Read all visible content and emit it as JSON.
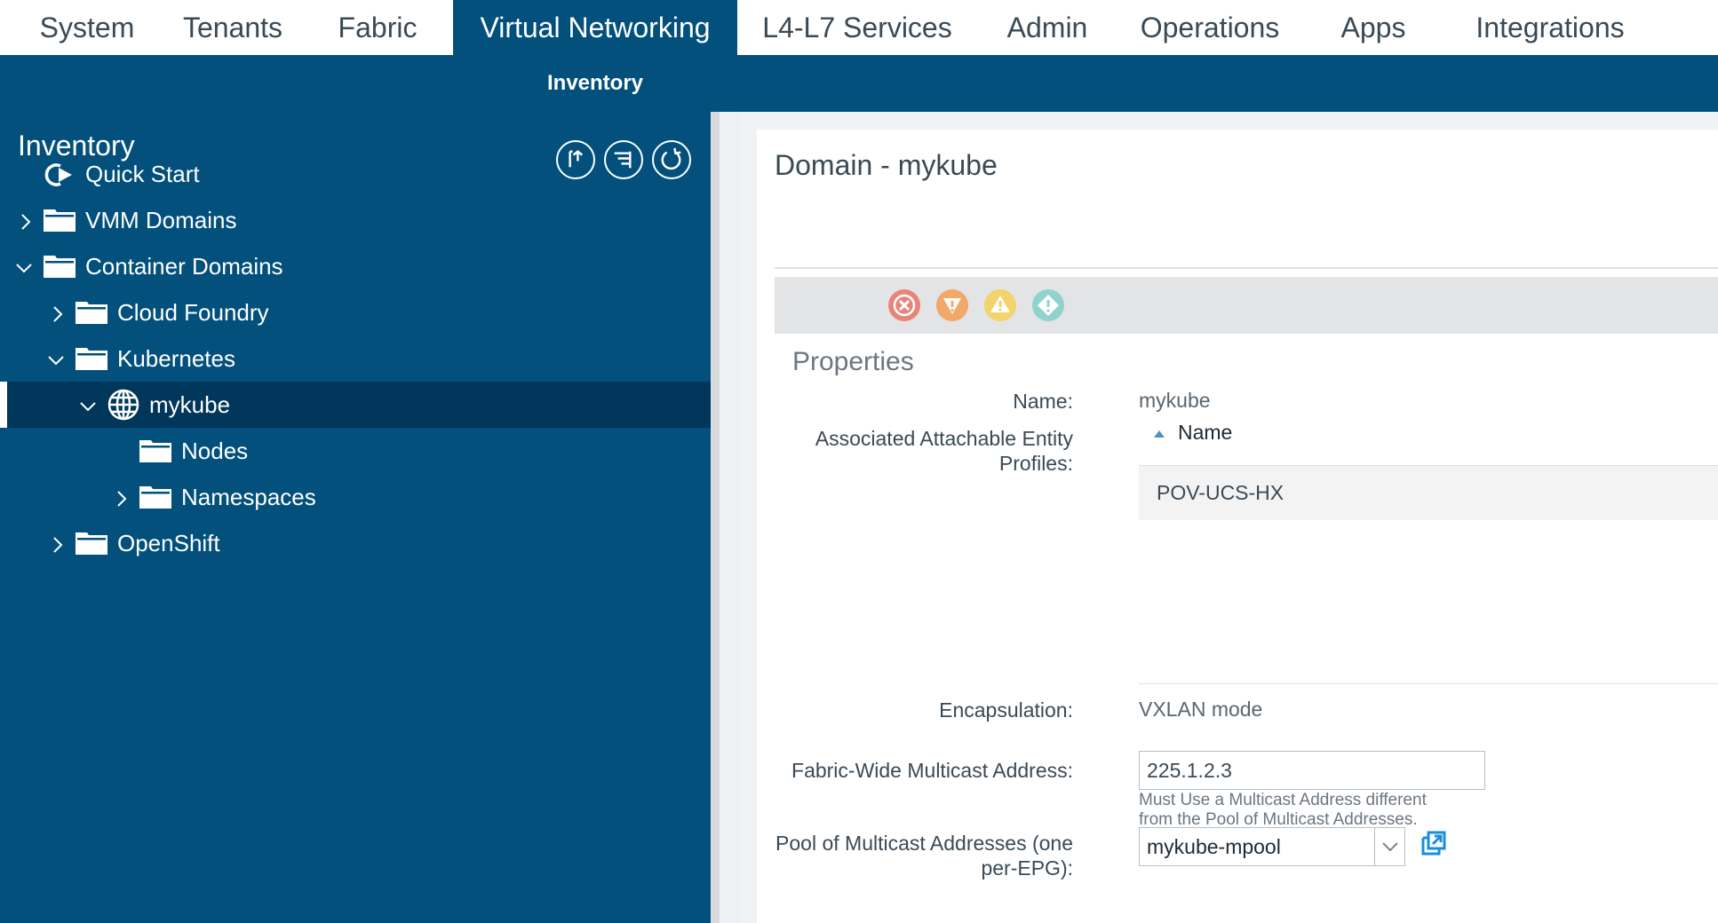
{
  "topnav": {
    "tabs": [
      {
        "label": "System"
      },
      {
        "label": "Tenants"
      },
      {
        "label": "Fabric"
      },
      {
        "label": "Virtual Networking",
        "active": true
      },
      {
        "label": "L4-L7 Services"
      },
      {
        "label": "Admin"
      },
      {
        "label": "Operations"
      },
      {
        "label": "Apps"
      },
      {
        "label": "Integrations"
      }
    ]
  },
  "subnav": {
    "active": "Inventory"
  },
  "sidebar": {
    "title": "Inventory",
    "actions": [
      "import-icon",
      "filter-list-icon",
      "refresh-icon"
    ],
    "tree": [
      {
        "label": "Quick Start",
        "icon": "quick-start-icon",
        "expanded": null
      },
      {
        "label": "VMM Domains",
        "icon": "folder-icon",
        "expanded": false
      },
      {
        "label": "Container Domains",
        "icon": "folder-icon",
        "expanded": true
      },
      {
        "label": "Cloud Foundry",
        "icon": "folder-icon",
        "expanded": false
      },
      {
        "label": "Kubernetes",
        "icon": "folder-icon",
        "expanded": true
      },
      {
        "label": "mykube",
        "icon": "globe-icon",
        "expanded": true,
        "selected": true
      },
      {
        "label": "Nodes",
        "icon": "folder-icon",
        "expanded": null
      },
      {
        "label": "Namespaces",
        "icon": "folder-icon",
        "expanded": false
      },
      {
        "label": "OpenShift",
        "icon": "folder-icon",
        "expanded": false
      }
    ]
  },
  "content": {
    "title": "Domain - mykube",
    "faults": [
      {
        "type": "critical",
        "color": "#e8857a"
      },
      {
        "type": "major",
        "color": "#f1a868"
      },
      {
        "type": "minor",
        "color": "#f3d36b"
      },
      {
        "type": "warning",
        "color": "#8fd3cc"
      }
    ],
    "properties": {
      "heading": "Properties",
      "name_label": "Name:",
      "name_value": "mykube",
      "aep_label_line1": "Associated Attachable Entity",
      "aep_label_line2": "Profiles:",
      "aep_column": "Name",
      "aep_rows": [
        "POV-UCS-HX"
      ],
      "encap_label": "Encapsulation:",
      "encap_value": "VXLAN mode",
      "mcast_label": "Fabric-Wide Multicast Address:",
      "mcast_value": "225.1.2.3",
      "mcast_help_line1": "Must Use a Multicast Address different",
      "mcast_help_line2": "from the Pool of Multicast Addresses.",
      "pool_label_line1": "Pool of Multicast Addresses (one",
      "pool_label_line2": "per-EPG):",
      "pool_value": "mykube-mpool"
    }
  },
  "colors": {
    "brand": "#02507b",
    "selected_row": "#01375a",
    "link_blue": "#1a8fd9"
  }
}
